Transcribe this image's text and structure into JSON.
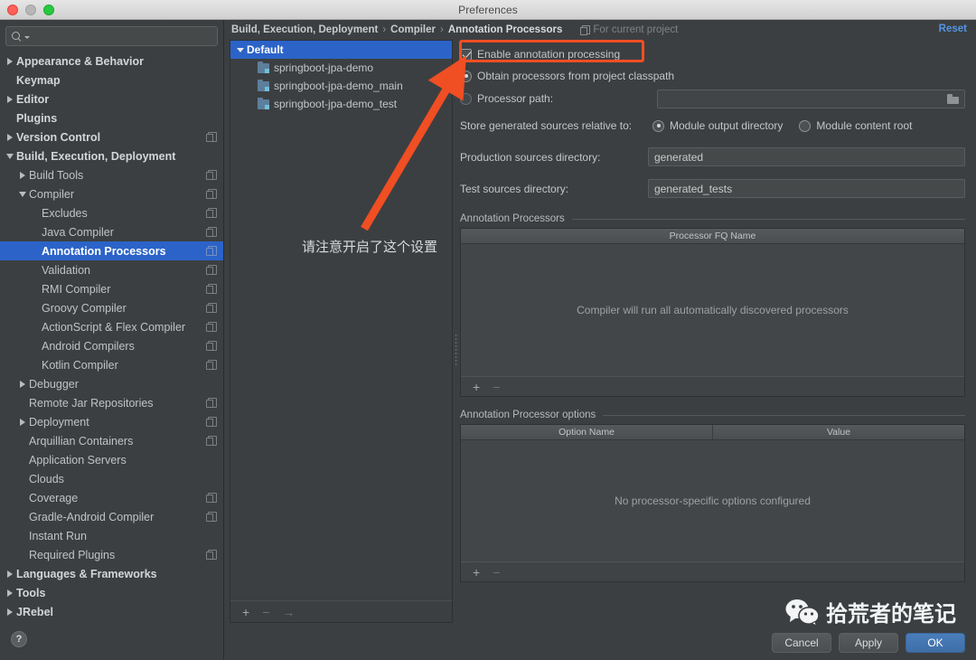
{
  "window": {
    "title": "Preferences"
  },
  "search": {
    "value": "",
    "placeholder": ""
  },
  "sidebar": {
    "items": [
      {
        "label": "Appearance & Behavior",
        "twisty": "right",
        "indent": 0,
        "bold": true,
        "marker": false,
        "selected": false
      },
      {
        "label": "Keymap",
        "twisty": "none",
        "indent": 0,
        "bold": true,
        "marker": false,
        "selected": false
      },
      {
        "label": "Editor",
        "twisty": "right",
        "indent": 0,
        "bold": true,
        "marker": false,
        "selected": false
      },
      {
        "label": "Plugins",
        "twisty": "none",
        "indent": 0,
        "bold": true,
        "marker": false,
        "selected": false
      },
      {
        "label": "Version Control",
        "twisty": "right",
        "indent": 0,
        "bold": true,
        "marker": true,
        "selected": false
      },
      {
        "label": "Build, Execution, Deployment",
        "twisty": "down",
        "indent": 0,
        "bold": true,
        "marker": false,
        "selected": false
      },
      {
        "label": "Build Tools",
        "twisty": "right",
        "indent": 1,
        "bold": false,
        "marker": true,
        "selected": false
      },
      {
        "label": "Compiler",
        "twisty": "down",
        "indent": 1,
        "bold": false,
        "marker": true,
        "selected": false
      },
      {
        "label": "Excludes",
        "twisty": "none",
        "indent": 2,
        "bold": false,
        "marker": true,
        "selected": false
      },
      {
        "label": "Java Compiler",
        "twisty": "none",
        "indent": 2,
        "bold": false,
        "marker": true,
        "selected": false
      },
      {
        "label": "Annotation Processors",
        "twisty": "none",
        "indent": 2,
        "bold": true,
        "marker": true,
        "selected": true
      },
      {
        "label": "Validation",
        "twisty": "none",
        "indent": 2,
        "bold": false,
        "marker": true,
        "selected": false
      },
      {
        "label": "RMI Compiler",
        "twisty": "none",
        "indent": 2,
        "bold": false,
        "marker": true,
        "selected": false
      },
      {
        "label": "Groovy Compiler",
        "twisty": "none",
        "indent": 2,
        "bold": false,
        "marker": true,
        "selected": false
      },
      {
        "label": "ActionScript & Flex Compiler",
        "twisty": "none",
        "indent": 2,
        "bold": false,
        "marker": true,
        "selected": false
      },
      {
        "label": "Android Compilers",
        "twisty": "none",
        "indent": 2,
        "bold": false,
        "marker": true,
        "selected": false
      },
      {
        "label": "Kotlin Compiler",
        "twisty": "none",
        "indent": 2,
        "bold": false,
        "marker": true,
        "selected": false
      },
      {
        "label": "Debugger",
        "twisty": "right",
        "indent": 1,
        "bold": false,
        "marker": false,
        "selected": false
      },
      {
        "label": "Remote Jar Repositories",
        "twisty": "none",
        "indent": 1,
        "bold": false,
        "marker": true,
        "selected": false
      },
      {
        "label": "Deployment",
        "twisty": "right",
        "indent": 1,
        "bold": false,
        "marker": true,
        "selected": false
      },
      {
        "label": "Arquillian Containers",
        "twisty": "none",
        "indent": 1,
        "bold": false,
        "marker": true,
        "selected": false
      },
      {
        "label": "Application Servers",
        "twisty": "none",
        "indent": 1,
        "bold": false,
        "marker": false,
        "selected": false
      },
      {
        "label": "Clouds",
        "twisty": "none",
        "indent": 1,
        "bold": false,
        "marker": false,
        "selected": false
      },
      {
        "label": "Coverage",
        "twisty": "none",
        "indent": 1,
        "bold": false,
        "marker": true,
        "selected": false
      },
      {
        "label": "Gradle-Android Compiler",
        "twisty": "none",
        "indent": 1,
        "bold": false,
        "marker": true,
        "selected": false
      },
      {
        "label": "Instant Run",
        "twisty": "none",
        "indent": 1,
        "bold": false,
        "marker": false,
        "selected": false
      },
      {
        "label": "Required Plugins",
        "twisty": "none",
        "indent": 1,
        "bold": false,
        "marker": true,
        "selected": false
      },
      {
        "label": "Languages & Frameworks",
        "twisty": "right",
        "indent": 0,
        "bold": true,
        "marker": false,
        "selected": false
      },
      {
        "label": "Tools",
        "twisty": "right",
        "indent": 0,
        "bold": true,
        "marker": false,
        "selected": false
      },
      {
        "label": "JRebel",
        "twisty": "right",
        "indent": 0,
        "bold": true,
        "marker": false,
        "selected": false
      }
    ],
    "help_label": "?"
  },
  "breadcrumb": {
    "parts": [
      "Build, Execution, Deployment",
      "Compiler",
      "Annotation Processors"
    ],
    "separator": "›",
    "scope_label": "For current project",
    "reset_label": "Reset"
  },
  "profiles": {
    "root": "Default",
    "modules": [
      "springboot-jpa-demo",
      "springboot-jpa-demo_main",
      "springboot-jpa-demo_test"
    ],
    "toolbar": {
      "add": "+",
      "remove": "−",
      "move": "→"
    }
  },
  "settings": {
    "enable_annotation_processing": {
      "label": "Enable annotation processing",
      "checked": true
    },
    "processor_source": {
      "obtain_from_classpath": {
        "label": "Obtain processors from project classpath",
        "selected": true
      },
      "processor_path": {
        "label": "Processor path:",
        "selected": false,
        "value": ""
      }
    },
    "store_generated": {
      "label": "Store generated sources relative to:",
      "options": [
        {
          "label": "Module output directory",
          "selected": true
        },
        {
          "label": "Module content root",
          "selected": false
        }
      ]
    },
    "production_sources": {
      "label": "Production sources directory:",
      "value": "generated"
    },
    "test_sources": {
      "label": "Test sources directory:",
      "value": "generated_tests"
    },
    "annotation_processors": {
      "title": "Annotation Processors",
      "columns": [
        "Processor FQ Name"
      ],
      "empty_text": "Compiler will run all automatically discovered processors",
      "toolbar": {
        "add": "+",
        "remove": "−"
      }
    },
    "processor_options": {
      "title": "Annotation Processor options",
      "columns": [
        "Option Name",
        "Value"
      ],
      "empty_text": "No processor-specific options configured",
      "toolbar": {
        "add": "+",
        "remove": "−"
      }
    }
  },
  "buttons": {
    "cancel": "Cancel",
    "apply": "Apply",
    "ok": "OK"
  },
  "annotations": {
    "note_text": "请注意开启了这个设置",
    "highlight_color": "#f04e23",
    "arrow_color": "#f04e23"
  },
  "watermark": {
    "text": "拾荒者的笔记"
  },
  "colors": {
    "background": "#3c3f41",
    "selection": "#2b63c8",
    "accent_link": "#5294e2",
    "primary_button": "#4a7ebb"
  }
}
